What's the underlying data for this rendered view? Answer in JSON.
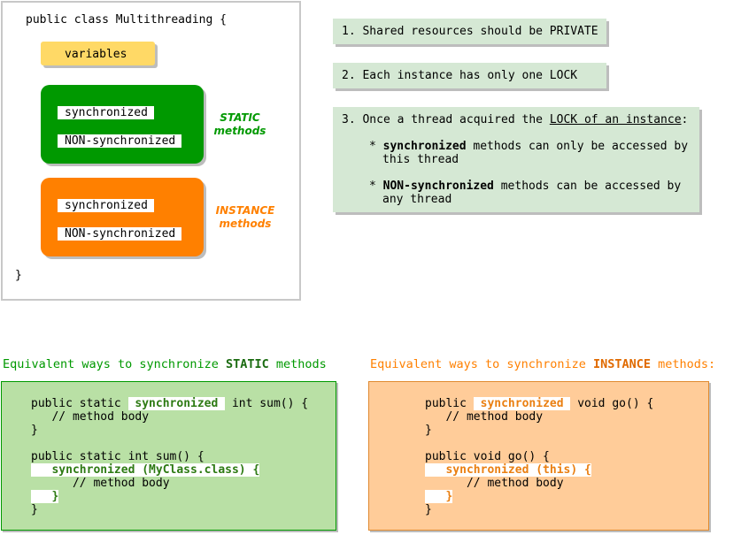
{
  "class_box": {
    "header": "public class Multithreading {",
    "footer": "}",
    "variables": "variables",
    "static_group": {
      "synchronized": "synchronized",
      "non_synchronized": "NON-synchronized",
      "label": "STATIC\nmethods"
    },
    "instance_group": {
      "synchronized": "synchronized",
      "non_synchronized": "NON-synchronized",
      "label": "INSTANCE\nmethods"
    }
  },
  "notes": {
    "note1": "1. Shared resources should be PRIVATE",
    "note2": "2. Each instance has only one LOCK",
    "note3": {
      "prefix": "3. Once a thread acquired the ",
      "underlined": "LOCK of an instance",
      "suffix": ":",
      "bullet1_bold": "synchronized",
      "bullet1_rest": " methods can only be accessed by",
      "bullet1_cont": "this thread",
      "bullet2_bold": "NON-synchronized",
      "bullet2_rest": " methods can be accessed by",
      "bullet2_cont": "any thread",
      "bullet_mark": "*"
    }
  },
  "static_section": {
    "title_prefix": "Equivalent ways to synchronize ",
    "title_bold": "STATIC",
    "title_suffix": " methods",
    "line1_a": "public static ",
    "line1_kw": " synchronized ",
    "line1_b": " int sum() {",
    "line2": "   // method body",
    "line3": "}",
    "line5": "public static int sum() {",
    "line6": "   synchronized (MyClass.class) {",
    "line7": "      // method body",
    "line8": "   }",
    "line9": "}"
  },
  "instance_section": {
    "title_prefix": "Equivalent ways to synchronize ",
    "title_bold": "INSTANCE",
    "title_suffix": " methods:",
    "line1_a": "public ",
    "line1_kw": " synchronized ",
    "line1_b": " void go() {",
    "line2": "   // method body",
    "line3": "}",
    "line5": "public void go() {",
    "line6": "   synchronized (this) {",
    "line7": "      // method body",
    "line8": "   }",
    "line9": "}"
  },
  "colors": {
    "static_green": "#009900",
    "instance_orange": "#ff8000",
    "variables_yellow": "#ffd966",
    "note_green": "#d5e8d4",
    "code_green": "#b9e0a5",
    "code_orange": "#ffcc99"
  }
}
